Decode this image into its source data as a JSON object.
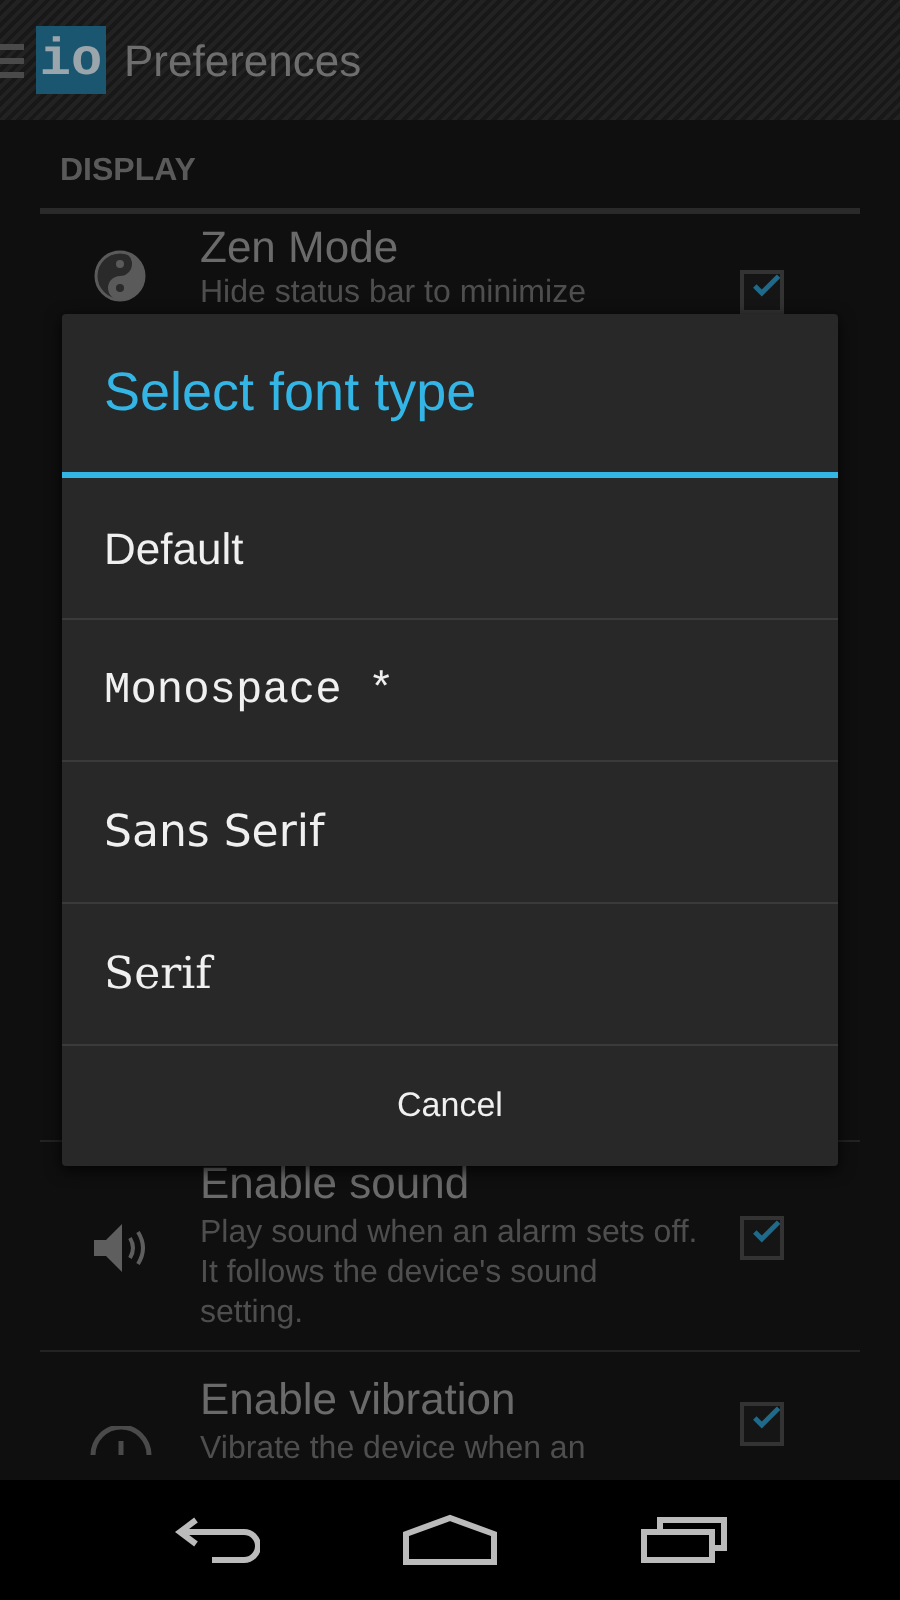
{
  "action_bar": {
    "logo_text": "io",
    "title": "Preferences"
  },
  "section": {
    "header": "DISPLAY"
  },
  "background_rows": [
    {
      "kind": "zen",
      "title": "Zen Mode",
      "description": "Hide status bar to minimize",
      "checked": true
    },
    {
      "kind": "sound",
      "title": "Enable sound",
      "description": "Play sound when an alarm sets off. It follows the device's sound setting.",
      "checked": true
    },
    {
      "kind": "vibration",
      "title": "Enable vibration",
      "description": "Vibrate the device when an",
      "checked": true
    }
  ],
  "dialog": {
    "title": "Select font type",
    "options": [
      {
        "kind": "default",
        "label": "Default"
      },
      {
        "kind": "monospace",
        "label": "Monospace *"
      },
      {
        "kind": "sans",
        "label": "Sans Serif"
      },
      {
        "kind": "serif",
        "label": "Serif"
      }
    ],
    "cancel": "Cancel"
  }
}
